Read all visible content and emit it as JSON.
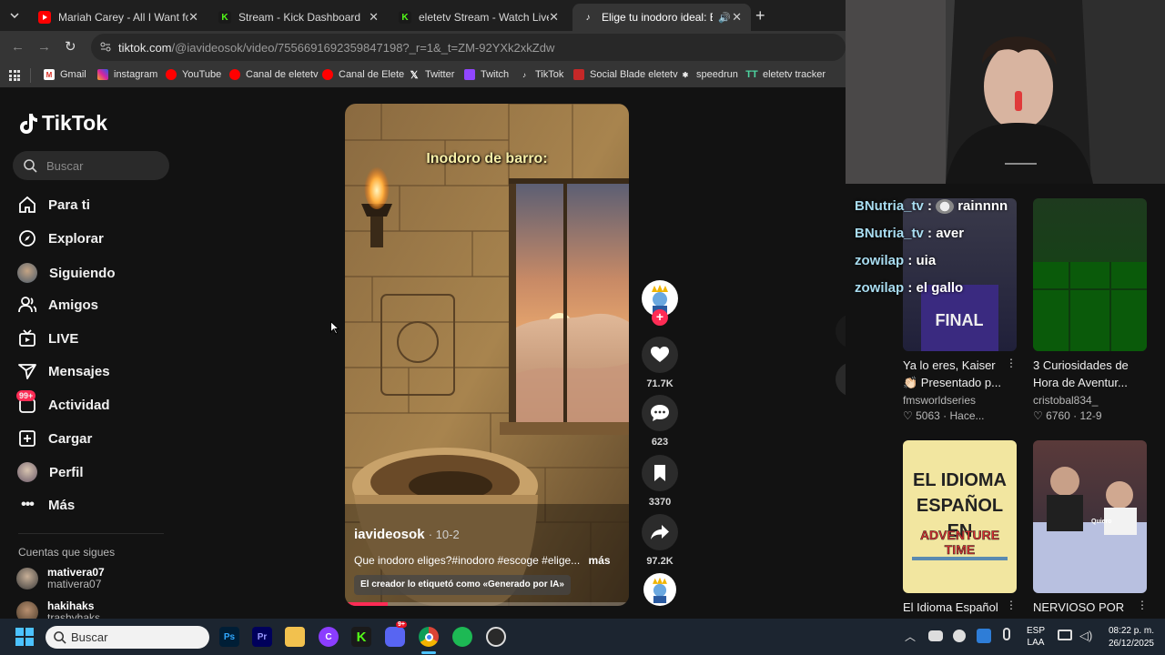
{
  "browser": {
    "tabs": [
      {
        "title": "Mariah Carey - All I Want for Christmas Is You",
        "favicon_color": "#ff0000"
      },
      {
        "title": "Stream - Kick Dashboard",
        "favicon_color": "#53fc18"
      },
      {
        "title": "eletetv Stream - Watch Live on Kick",
        "favicon_color": "#53fc18"
      },
      {
        "title": "Elige tu inodoro ideal: Estilo",
        "favicon_color": "#ffffff"
      }
    ],
    "url_domain": "tiktok.com",
    "url_path": "/@iavideosok/video/7556691692359847198?_r=1&_t=ZM-92YXk2xkZdw",
    "bookmarks": [
      "Gmail",
      "instagram",
      "YouTube",
      "Canal de eletetv",
      "Canal de Elete",
      "Twitter",
      "Twitch",
      "TikTok",
      "Social Blade eletetv",
      "speedrun",
      "eletetv tracker"
    ]
  },
  "tiktok": {
    "logo": "TikTok",
    "search_placeholder": "Buscar",
    "nav": [
      {
        "label": "Para ti",
        "icon": "home-icon"
      },
      {
        "label": "Explorar",
        "icon": "compass-icon"
      },
      {
        "label": "Siguiendo",
        "icon": "avatar-icon"
      },
      {
        "label": "Amigos",
        "icon": "friends-icon"
      },
      {
        "label": "LIVE",
        "icon": "live-icon"
      },
      {
        "label": "Mensajes",
        "icon": "send-icon"
      },
      {
        "label": "Actividad",
        "icon": "activity-icon",
        "badge": "99+"
      },
      {
        "label": "Cargar",
        "icon": "upload-icon"
      },
      {
        "label": "Perfil",
        "icon": "profile-icon"
      },
      {
        "label": "Más",
        "icon": "more-icon"
      }
    ],
    "following_header": "Cuentas que sigues",
    "following": [
      {
        "name": "mativera07",
        "handle": "mativera07"
      },
      {
        "name": "hakihaks",
        "handle": "trashyhaks"
      }
    ],
    "video": {
      "overlay_text": "Inodoro de barro:",
      "author": "iavideosok",
      "date": "10-2",
      "caption": "Que inodoro eliges?#inodoro #escoge #elige...",
      "more": "más",
      "ai_label": "El creador lo etiquetó como «Generado por IA»",
      "progress": 0.15
    },
    "actions": {
      "likes": "71.7K",
      "comments": "623",
      "saves": "3370",
      "shares": "97.2K"
    }
  },
  "stream_chat": [
    {
      "user": "BNutria_tv",
      "message": "rainnnn"
    },
    {
      "user": "BNutria_tv",
      "message": "aver"
    },
    {
      "user": "zowilap",
      "message": "uia"
    },
    {
      "user": "zowilap",
      "message": "el gallo"
    }
  ],
  "recommended": [
    {
      "title_lines": [
        "Ya lo eres, Kaiser",
        "👏🏻 Presentado p..."
      ],
      "author": "fmsworldseries",
      "likes": "5063",
      "date": "Hace..."
    },
    {
      "title_lines": [
        "3 Curiosidades de",
        "Hora de Aventur..."
      ],
      "author": "cristobal834_",
      "likes": "6760",
      "date": "12-9"
    },
    {
      "title_lines": [
        "El Idioma Español"
      ],
      "thumb_text": [
        "EL IDIOMA",
        "ESPAÑOL EN"
      ],
      "thumb_logo": "ADVENTURE TIME"
    },
    {
      "title_lines": [
        "NERVIOSO POR"
      ],
      "thumb_text": [
        "Quiero"
      ]
    }
  ],
  "taskbar": {
    "search_placeholder": "Buscar",
    "lang": "ESP",
    "lang_sub": "LAA",
    "time": "08:22 p. m.",
    "date": "26/12/2025",
    "discord_badge": "9+"
  },
  "colors": {
    "tiktok_red": "#fe2c55",
    "background": "#121212",
    "chat_username": "#a8dcf0"
  }
}
